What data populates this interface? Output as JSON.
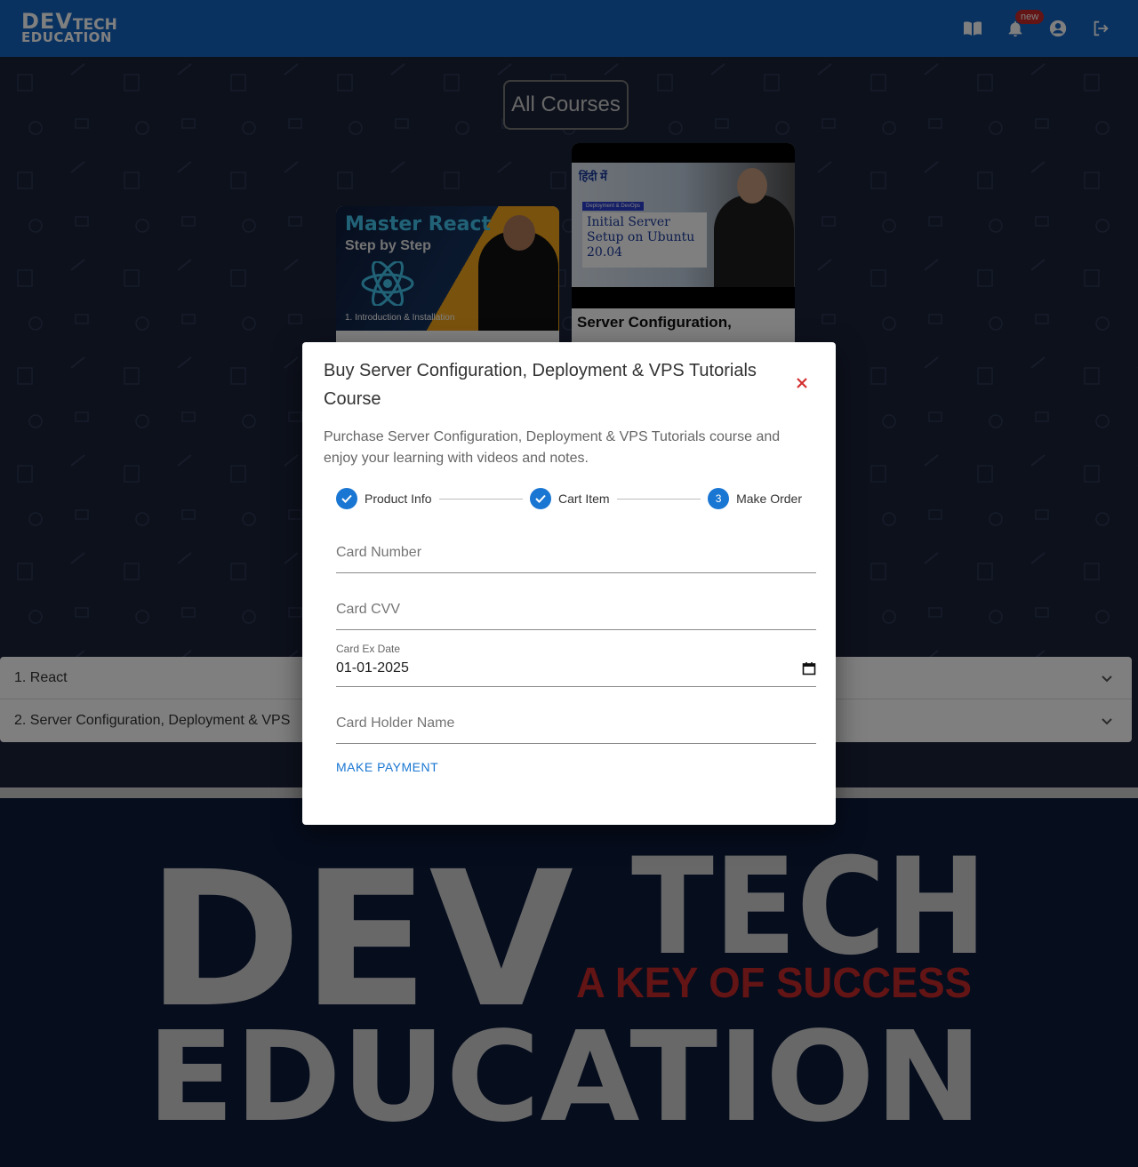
{
  "header": {
    "logo_dev": "DEV",
    "logo_tech": "TECH",
    "logo_edu": "EDUCATION",
    "notification_badge": "new",
    "icons": [
      "book-icon",
      "bell-icon",
      "account-icon",
      "logout-icon"
    ]
  },
  "page": {
    "heading": "All Courses",
    "course_cards": [
      {
        "thumb_title_1": "Master",
        "thumb_title_2": "React",
        "thumb_subtitle": "Step by Step",
        "thumb_caption": "1. Introduction & Installation"
      },
      {
        "thumb_hindi": "हिंदी में",
        "thumb_tag": "Deployment & DevOps",
        "thumb_title": "Initial Server Setup on Ubuntu 20.04",
        "title": "Server Configuration,"
      }
    ],
    "accordion": [
      {
        "label": "1. React"
      },
      {
        "label": "2. Server Configuration, Deployment & VPS"
      }
    ]
  },
  "footer": {
    "big_logo_dev": "DEV",
    "big_logo_tech": "TECH",
    "big_logo_tagline": "A KEY OF SUCCESS",
    "big_logo_edu": "EDUCATION"
  },
  "modal": {
    "title": "Buy Server Configuration, Deployment & VPS Tutorials Course",
    "description": "Purchase Server Configuration, Deployment & VPS Tutorials course and enjoy your learning with videos and notes.",
    "steps": [
      {
        "label": "Product Info",
        "state": "completed"
      },
      {
        "label": "Cart Item",
        "state": "completed"
      },
      {
        "label": "Make Order",
        "state": "active",
        "number": "3"
      }
    ],
    "fields": {
      "card_number_placeholder": "Card Number",
      "card_cvv_placeholder": "Card CVV",
      "card_exp_label": "Card Ex Date",
      "card_exp_value": "01-01-2025",
      "card_holder_placeholder": "Card Holder Name"
    },
    "pay_button": "MAKE PAYMENT"
  },
  "colors": {
    "header": "#1565c0",
    "accent": "#1976d2",
    "close": "#d32f2f",
    "tagline": "#c62828"
  }
}
